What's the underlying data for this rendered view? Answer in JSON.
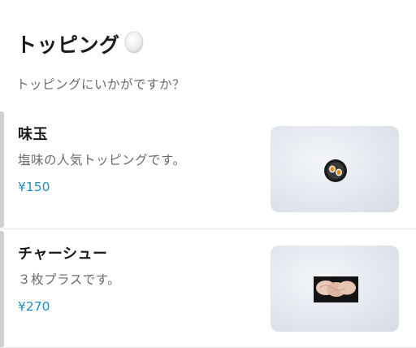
{
  "header": {
    "title": "トッピング",
    "title_icon": "egg-icon",
    "subtitle": "トッピングにいかがですか？"
  },
  "items": [
    {
      "name": "味玉",
      "description": "塩味の人気トッピングです。",
      "price": "¥150",
      "image": "ajitama-bowl"
    },
    {
      "name": "チャーシュー",
      "description": "３枚プラスです。",
      "price": "¥270",
      "image": "chashu-plate"
    }
  ],
  "colors": {
    "price": "#1e8ec8",
    "accent_bar": "#cfcfcf"
  }
}
